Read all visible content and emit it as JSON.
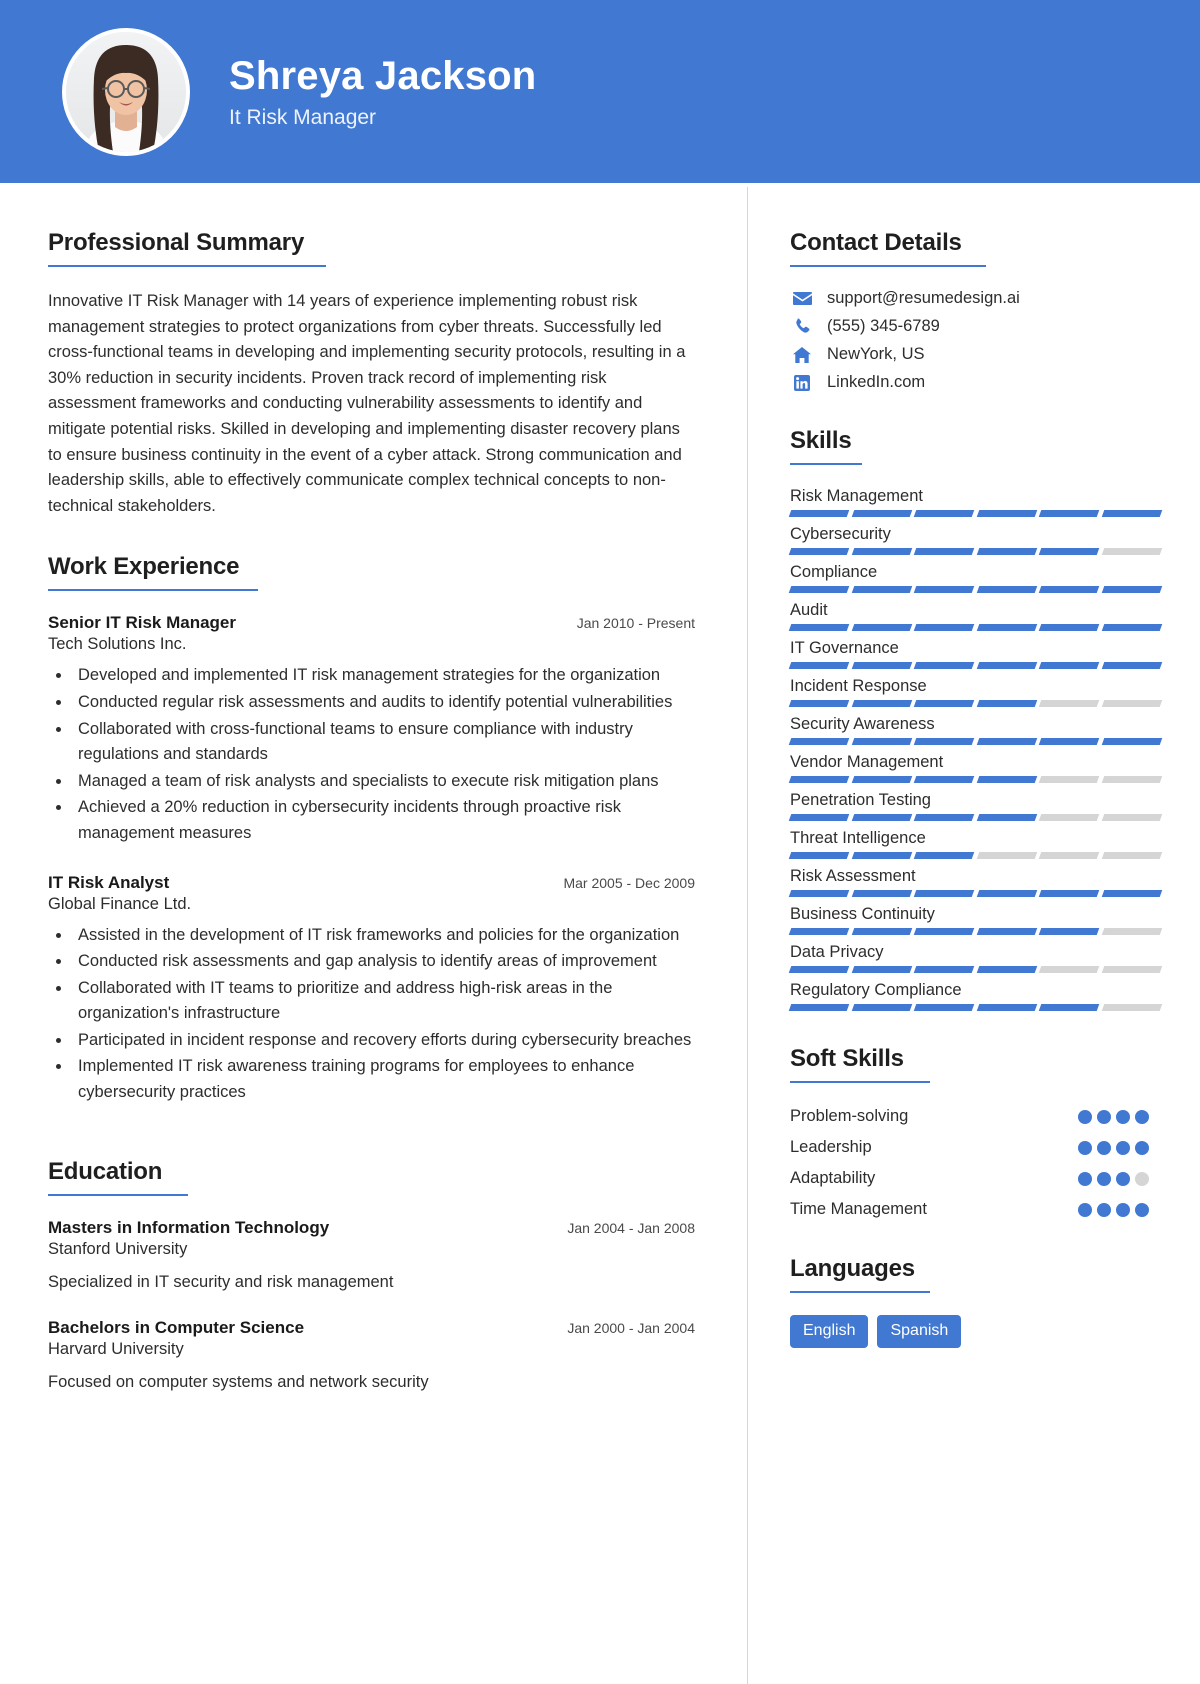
{
  "header": {
    "name": "Shreya Jackson",
    "job_title": "It Risk Manager",
    "bg_color": "#4078d2",
    "avatar_alt": "profile-photo"
  },
  "left": {
    "summary_heading": "Professional Summary",
    "summary_text": "Innovative IT Risk Manager with 14 years of experience implementing robust risk management strategies to protect organizations from cyber threats. Successfully led cross-functional teams in developing and implementing security protocols, resulting in a 30% reduction in security incidents. Proven track record of implementing risk assessment frameworks and conducting vulnerability assessments to identify and mitigate potential risks. Skilled in developing and implementing disaster recovery plans to ensure business continuity in the event of a cyber attack. Strong communication and leadership skills, able to effectively communicate complex technical concepts to non-technical stakeholders.",
    "work_heading": "Work Experience",
    "work": [
      {
        "role": "Senior IT Risk Manager",
        "date": "Jan 2010 - Present",
        "org": "Tech Solutions Inc.",
        "bullets": [
          "Developed and implemented IT risk management strategies for the organization",
          "Conducted regular risk assessments and audits to identify potential vulnerabilities",
          "Collaborated with cross-functional teams to ensure compliance with industry regulations and standards",
          "Managed a team of risk analysts and specialists to execute risk mitigation plans",
          "Achieved a 20% reduction in cybersecurity incidents through proactive risk management measures"
        ]
      },
      {
        "role": "IT Risk Analyst",
        "date": "Mar 2005 - Dec 2009",
        "org": "Global Finance Ltd.",
        "bullets": [
          "Assisted in the development of IT risk frameworks and policies for the organization",
          "Conducted risk assessments and gap analysis to identify areas of improvement",
          "Collaborated with IT teams to prioritize and address high-risk areas in the organization's infrastructure",
          "Participated in incident response and recovery efforts during cybersecurity breaches",
          "Implemented IT risk awareness training programs for employees to enhance cybersecurity practices"
        ]
      }
    ],
    "education_heading": "Education",
    "education": [
      {
        "degree": "Masters in Information Technology",
        "date": "Jan 2004 - Jan 2008",
        "school": "Stanford University",
        "note": "Specialized in IT security and risk management"
      },
      {
        "degree": "Bachelors in Computer Science",
        "date": "Jan 2000 - Jan 2004",
        "school": "Harvard University",
        "note": "Focused on computer systems and network security"
      }
    ]
  },
  "right": {
    "contact_heading": "Contact Details",
    "contact": [
      {
        "icon": "envelope-icon",
        "value": "support@resumedesign.ai"
      },
      {
        "icon": "phone-icon",
        "value": "(555) 345-6789"
      },
      {
        "icon": "home-icon",
        "value": "NewYork, US"
      },
      {
        "icon": "linkedin-icon",
        "value": "LinkedIn.com"
      }
    ],
    "skills_heading": "Skills",
    "skills_total_segments": 6,
    "skills": [
      {
        "name": "Risk Management",
        "filled": 6
      },
      {
        "name": "Cybersecurity",
        "filled": 5
      },
      {
        "name": "Compliance",
        "filled": 6
      },
      {
        "name": "Audit",
        "filled": 6
      },
      {
        "name": "IT Governance",
        "filled": 6
      },
      {
        "name": "Incident Response",
        "filled": 4
      },
      {
        "name": "Security Awareness",
        "filled": 6
      },
      {
        "name": "Vendor Management",
        "filled": 4
      },
      {
        "name": "Penetration Testing",
        "filled": 4
      },
      {
        "name": "Threat Intelligence",
        "filled": 3
      },
      {
        "name": "Risk Assessment",
        "filled": 6
      },
      {
        "name": "Business Continuity",
        "filled": 5
      },
      {
        "name": "Data Privacy",
        "filled": 4
      },
      {
        "name": "Regulatory Compliance",
        "filled": 5
      }
    ],
    "soft_heading": "Soft Skills",
    "soft_total_dots": 4,
    "soft_skills": [
      {
        "name": "Problem-solving",
        "filled": 4
      },
      {
        "name": "Leadership",
        "filled": 4
      },
      {
        "name": "Adaptability",
        "filled": 3
      },
      {
        "name": "Time Management",
        "filled": 4
      }
    ],
    "languages_heading": "Languages",
    "languages": [
      "English",
      "Spanish"
    ]
  },
  "colors": {
    "accent": "#4078d2",
    "bar_empty": "#d5d5d5",
    "text": "#2d2d2d"
  }
}
